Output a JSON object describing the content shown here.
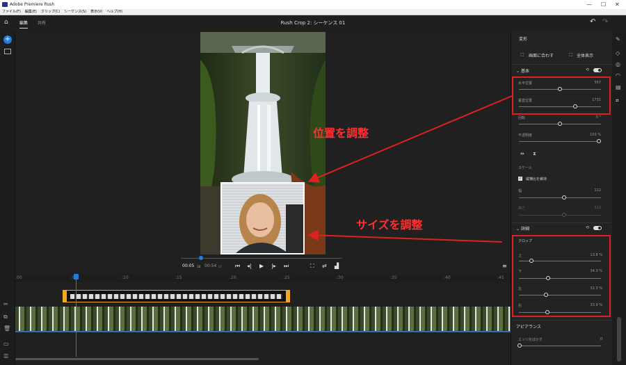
{
  "window": {
    "title": "Adobe Premiere Rush",
    "min": "—",
    "max": "☐",
    "close": "✕"
  },
  "menu": [
    "ファイル(F)",
    "編集(E)",
    "クリップ(C)",
    "シーケンス(S)",
    "表示(V)",
    "ヘルプ(H)"
  ],
  "header": {
    "tabs": [
      "編集",
      "共有"
    ],
    "sequence_title": "Rush Crop 2: シーケンス 01",
    "undo": "↶",
    "redo": "↷"
  },
  "player": {
    "current_time": "00:05",
    "current_frame": "18",
    "duration": "00:54",
    "duration_frame": "07",
    "scrub_fraction": 0.1
  },
  "ruler": [
    ":00",
    ":05",
    ":10",
    ":15",
    ":20",
    ":25",
    ":30",
    ":35",
    ":40",
    ":45"
  ],
  "callouts": {
    "position": "位置を調整",
    "size": "サイズを調整"
  },
  "panel": {
    "title": "変形",
    "fit_button": "画面に合わす",
    "full_button": "全体表示",
    "basic": {
      "title": "基本",
      "h_pos": {
        "label": "水平位置",
        "value": "557",
        "fraction": 0.48
      },
      "v_pos": {
        "label": "垂直位置",
        "value": "1731",
        "fraction": 0.72
      },
      "rotation": {
        "label": "回転",
        "value": "0 °",
        "fraction": 0.48
      },
      "opacity": {
        "label": "不透明度",
        "value": "100 %",
        "fraction": 1.0
      },
      "scale_label": "スケール",
      "keep_ratio": "縦横比を維持",
      "width": {
        "label": "幅",
        "value": "112",
        "fraction": 0.55
      },
      "height": {
        "label": "高さ",
        "value": "112",
        "fraction": 0.55
      }
    },
    "detail": {
      "title": "詳細",
      "crop_label": "クロップ",
      "top": {
        "label": "上",
        "value": "13.8 %",
        "fraction": 0.14
      },
      "bottom": {
        "label": "下",
        "value": "34.3 %",
        "fraction": 0.34
      },
      "left": {
        "label": "左",
        "value": "32.3 %",
        "fraction": 0.32
      },
      "right": {
        "label": "右",
        "value": "33.9 %",
        "fraction": 0.34
      }
    },
    "appearance": {
      "title": "アピアランス",
      "edge_blur": {
        "label": "エッジをぼかす",
        "value": "0",
        "fraction": 0.0
      }
    }
  }
}
